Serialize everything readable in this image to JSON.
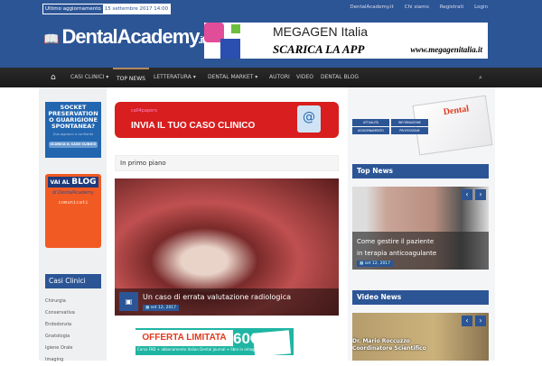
{
  "topbar": {
    "update_label": "Ultimo aggiornamento",
    "update_date": "15 settembre 2017 14:00",
    "links": [
      "DentalAcademy.it",
      "Chi siamo",
      "Registrati",
      "Login"
    ]
  },
  "logo": {
    "name": "DentalAcademy",
    "tld": ".it"
  },
  "header_ad": {
    "brand": "MEGAGEN Italia",
    "cta": "SCARICA LA APP",
    "url": "www.megagenitalia.it"
  },
  "nav": {
    "home_icon": "home-icon",
    "items": [
      "CASI CLINICI ▾",
      "TOP NEWS",
      "LETTERATURA ▾",
      "DENTAL MARKET ▾",
      "AUTORI",
      "VIDEO",
      "DENTAL BLOG"
    ],
    "search_icon": "search-icon"
  },
  "left": {
    "socket_ad": {
      "title": "SOCKET PRESERVATION O GUARIGIONE SPONTANEA?",
      "subtitle": "Due approcci a confronto",
      "button": "SCARICA IL CASO CLINICO"
    },
    "blog_ad": {
      "prefix": "VAI AL",
      "title": "BLOG",
      "brand": "di DentalAcademy",
      "tag": "comunicati"
    },
    "casi_title": "Casi Clinici",
    "casi_items": [
      "Chirurgia",
      "Conservativa",
      "Endodonzia",
      "Gnatologia",
      "Igiene Orale",
      "Imaging"
    ]
  },
  "center": {
    "c4p": {
      "small": "call4papers",
      "title": "INVIA IL TUO CASO CLINICO"
    },
    "section_title": "In primo piano",
    "hero": {
      "title": "Un caso di errata valutazione radiologica",
      "date": "set 12, 2017"
    },
    "offer": {
      "title": "OFFERTA LIMITATA",
      "price": "60€",
      "subtitle": "Corso FAD + abbonamento Italian Dental Journal + libro in omaggio"
    }
  },
  "right": {
    "dj_tabs": [
      "ATTUALITÀ",
      "INFORMAZIONE",
      "AGGIORNAMENTO",
      "PROFESSIONE"
    ],
    "dj_logo": "Dental",
    "top_news_title": "Top News",
    "top_news": {
      "title_l1": "Come gestire il paziente",
      "title_l2": "in terapia anticoagulante",
      "date": "set 12, 2017"
    },
    "video_news_title": "Video News",
    "video": {
      "l1": "Dr. Mario Roccuzzo",
      "l2": "Coordinatore Scientifico"
    }
  },
  "colors": {
    "brand_blue": "#2c5596",
    "nav_dark": "#1f1f1f",
    "accent_red": "#d81e1e",
    "orange": "#f15a22"
  }
}
